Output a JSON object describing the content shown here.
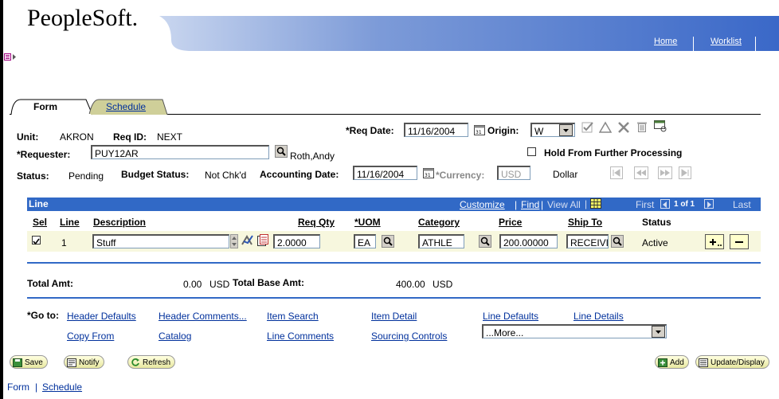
{
  "header": {
    "logo": "PeopleSoft.",
    "home_link": "Home",
    "worklist_link": "Worklist"
  },
  "tabs": [
    {
      "label": "Form"
    },
    {
      "label": "Schedule"
    }
  ],
  "form": {
    "unit_label": "Unit:",
    "unit_value": "AKRON",
    "req_id_label": "Req ID:",
    "req_id_value": "NEXT",
    "req_date_label": "*Req Date:",
    "req_date_value": "11/16/2004",
    "origin_label": "Origin:",
    "origin_value": "W",
    "requester_label": "*Requester:",
    "requester_value": "PUY12AR",
    "requester_name": "Roth,Andy",
    "hold_label": "Hold From Further Processing",
    "status_label": "Status:",
    "status_value": "Pending",
    "budget_status_label": "Budget Status:",
    "budget_status_value": "Not Chk'd",
    "accounting_date_label": "Accounting Date:",
    "accounting_date_value": "11/16/2004",
    "currency_label": "*Currency:",
    "currency_value": "USD",
    "currency_desc": "Dollar"
  },
  "grid": {
    "title": "Line",
    "customize": "Customize",
    "find": "Find",
    "view_all": "View All",
    "first": "First",
    "range": "1 of 1",
    "last": "Last",
    "columns": {
      "sel": "Sel",
      "line": "Line",
      "description": "Description",
      "req_qty": "Req Qty",
      "uom": "*UOM",
      "category": "Category",
      "price": "Price",
      "ship_to": "Ship To",
      "status": "Status"
    },
    "row": {
      "line": "1",
      "description": "Stuff",
      "req_qty": "2.0000",
      "uom": "EA",
      "category": "ATHLE",
      "price": "200.00000",
      "ship_to": "RECEIVI",
      "status": "Active",
      "selected": true
    }
  },
  "totals": {
    "total_amt_label": "Total Amt:",
    "total_amt_value": "0.00",
    "total_amt_currency": "USD",
    "total_base_label": "Total Base Amt:",
    "total_base_value": "400.00",
    "total_base_currency": "USD"
  },
  "goto": {
    "label": "*Go to:",
    "links": {
      "header_defaults": "Header Defaults",
      "header_comments": "Header Comments...",
      "item_search": "Item Search",
      "item_detail": "Item Detail",
      "line_defaults": "Line Defaults",
      "line_details": "Line Details",
      "copy_from": "Copy From",
      "catalog": "Catalog",
      "line_comments": "Line Comments",
      "sourcing_controls": "Sourcing Controls"
    },
    "more_select": "...More..."
  },
  "toolbar": {
    "save": "Save",
    "notify": "Notify",
    "refresh": "Refresh",
    "add": "Add",
    "update_display": "Update/Display"
  },
  "footer": {
    "form_link": "Form",
    "separator": "|",
    "schedule_link": "Schedule"
  },
  "colors": {
    "accent": "#3169c6",
    "link": "#00309c"
  }
}
